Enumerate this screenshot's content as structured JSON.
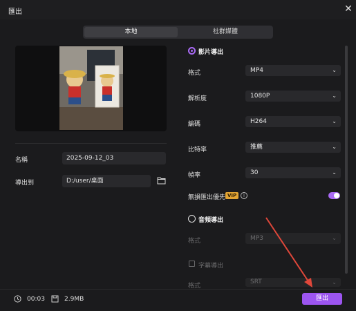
{
  "window": {
    "title": "匯出"
  },
  "tabs": [
    {
      "label": "本地",
      "active": true
    },
    {
      "label": "社群媒體",
      "active": false
    }
  ],
  "left": {
    "name_label": "名稱",
    "name_value": "2025-09-12_03",
    "export_to_label": "導出到",
    "export_to_value": "D:/user/桌面"
  },
  "video": {
    "section_label": "影片導出",
    "selected": true,
    "rows": [
      {
        "label": "格式",
        "value": "MP4"
      },
      {
        "label": "解析度",
        "value": "1080P"
      },
      {
        "label": "編碼",
        "value": "H264"
      },
      {
        "label": "比特率",
        "value": "推薦"
      },
      {
        "label": "幀率",
        "value": "30"
      }
    ],
    "lossless_label": "無損匯出優先",
    "vip_badge": "VIP",
    "lossless_on": true
  },
  "audio": {
    "section_label": "音頻導出",
    "selected": false,
    "format_label": "格式",
    "format_value": "MP3",
    "subtitle_label": "字幕導出",
    "subtitle_format_label": "格式",
    "subtitle_format_value": "SRT"
  },
  "footer": {
    "duration": "00:03",
    "size": "2.9MB",
    "export_button": "匯出"
  },
  "colors": {
    "accent": "#9c55f0",
    "vip": "#e3a534",
    "annotation_arrow": "#e0473a"
  }
}
